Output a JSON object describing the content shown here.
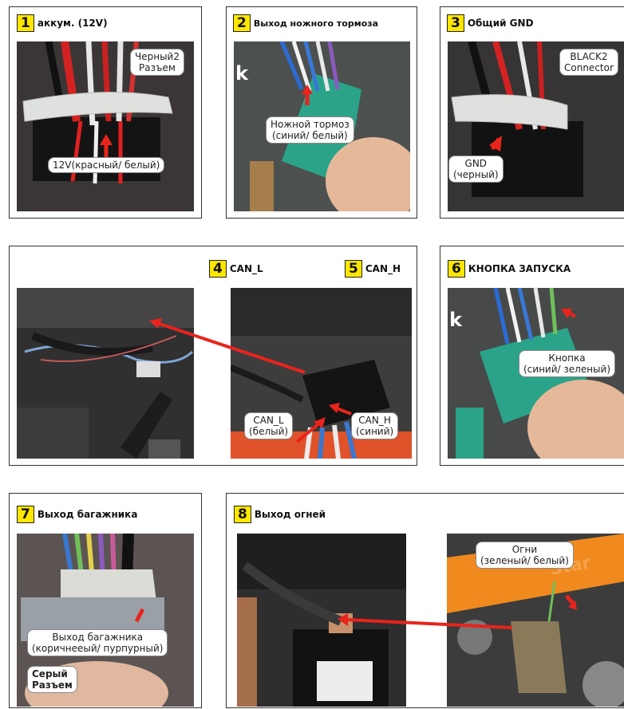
{
  "panels": {
    "p1": {
      "num": "1",
      "title": "аккум. (12V)",
      "labels": [
        "Черный2",
        "Разъем",
        "12V(красный/ белый)"
      ]
    },
    "p2": {
      "num": "2",
      "title": "Выход ножного тормоза",
      "labels": [
        "Ножной тормоз",
        "(синий/ белый)"
      ],
      "mark": "k"
    },
    "p3": {
      "num": "3",
      "title": "Общий GND",
      "labels": [
        "BLACK2",
        "Connector",
        "GND",
        "(черный)"
      ]
    },
    "p4": {
      "num": "4",
      "title": "CAN_L",
      "labels": [
        "CAN_L",
        "(белый)"
      ]
    },
    "p5": {
      "num": "5",
      "title": "CAN_H",
      "labels": [
        "CAN_H",
        "(синий)"
      ]
    },
    "p6": {
      "num": "6",
      "title": "КНОПКА ЗАПУСКА",
      "labels": [
        "Кнопка",
        "(синий/ зеленый)"
      ],
      "mark": "k"
    },
    "p7": {
      "num": "7",
      "title": "Выход багажника",
      "labels": [
        "Выход багажника",
        "(коричнееый/ пурпурный)",
        "Серый",
        "Разъем"
      ]
    },
    "p8": {
      "num": "8",
      "title": "Выход огней",
      "labels": [
        "Огни",
        "(зеленый/ белый)"
      ]
    }
  },
  "colors": {
    "badge": "#ffe600",
    "arrow": "#e8241c"
  }
}
